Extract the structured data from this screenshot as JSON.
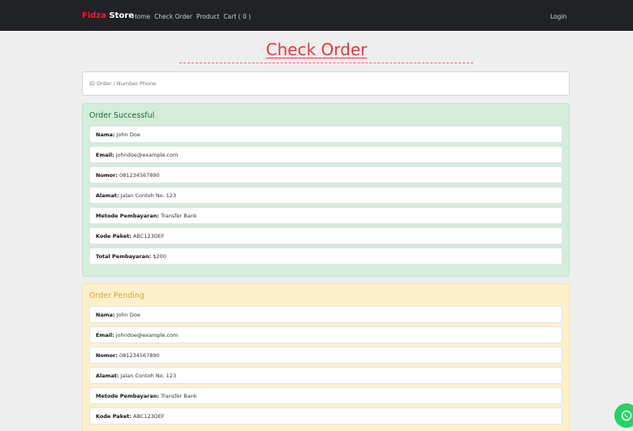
{
  "navbar": {
    "brand_part1": "Fidza",
    "brand_part2": "Store",
    "links": [
      "Home",
      "Check Order",
      "Product",
      "Cart ( 0 )"
    ],
    "login": "Login"
  },
  "page": {
    "title": "Check Order"
  },
  "search": {
    "placeholder": "ID Order / Number Phone"
  },
  "orders": [
    {
      "status": "Order Successful",
      "fields": [
        {
          "label": "Nama:",
          "value": "John Doe"
        },
        {
          "label": "Email:",
          "value": "johndoe@example.com"
        },
        {
          "label": "Nomor:",
          "value": "081234567890"
        },
        {
          "label": "Alamat:",
          "value": "Jalan Contoh No. 123"
        },
        {
          "label": "Metode Pembayaran:",
          "value": "Transfer Bank"
        },
        {
          "label": "Kode Paket:",
          "value": "ABC123DEF"
        },
        {
          "label": "Total Pembayaran:",
          "value": "$200"
        }
      ]
    },
    {
      "status": "Order Pending",
      "fields": [
        {
          "label": "Nama:",
          "value": "John Doe"
        },
        {
          "label": "Email:",
          "value": "johndoe@example.com"
        },
        {
          "label": "Nomor:",
          "value": "081234567890"
        },
        {
          "label": "Alamat:",
          "value": "Jalan Contoh No. 123"
        },
        {
          "label": "Metode Pembayaran:",
          "value": "Transfer Bank"
        },
        {
          "label": "Kode Paket:",
          "value": "ABC123DEF"
        }
      ]
    }
  ],
  "floating": {
    "icon": "whatsapp-icon",
    "color": "#25d366"
  }
}
